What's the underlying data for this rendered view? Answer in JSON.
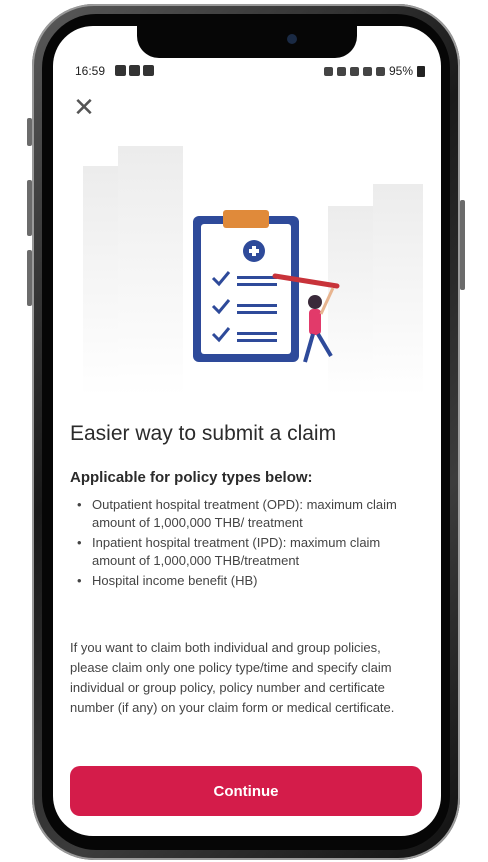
{
  "status_bar": {
    "time": "16:59",
    "battery": "95%"
  },
  "header": {
    "close_icon": "close-icon"
  },
  "content": {
    "title": "Easier way to submit a claim",
    "subtitle": "Applicable for policy types below:",
    "items": [
      "Outpatient hospital treatment (OPD): maximum claim amount of 1,000,000 THB/ treatment",
      "Inpatient hospital treatment (IPD): maximum claim amount of 1,000,000 THB/treatment",
      "Hospital income benefit (HB)"
    ],
    "note": "If you want to claim both individual and group policies, please claim only one policy type/time and specify claim individual or group policy, policy number and certificate number (if any) on your claim form or medical certificate."
  },
  "actions": {
    "continue_label": "Continue"
  },
  "colors": {
    "accent": "#d41c4a",
    "clipboard_blue": "#2e4a9a"
  }
}
